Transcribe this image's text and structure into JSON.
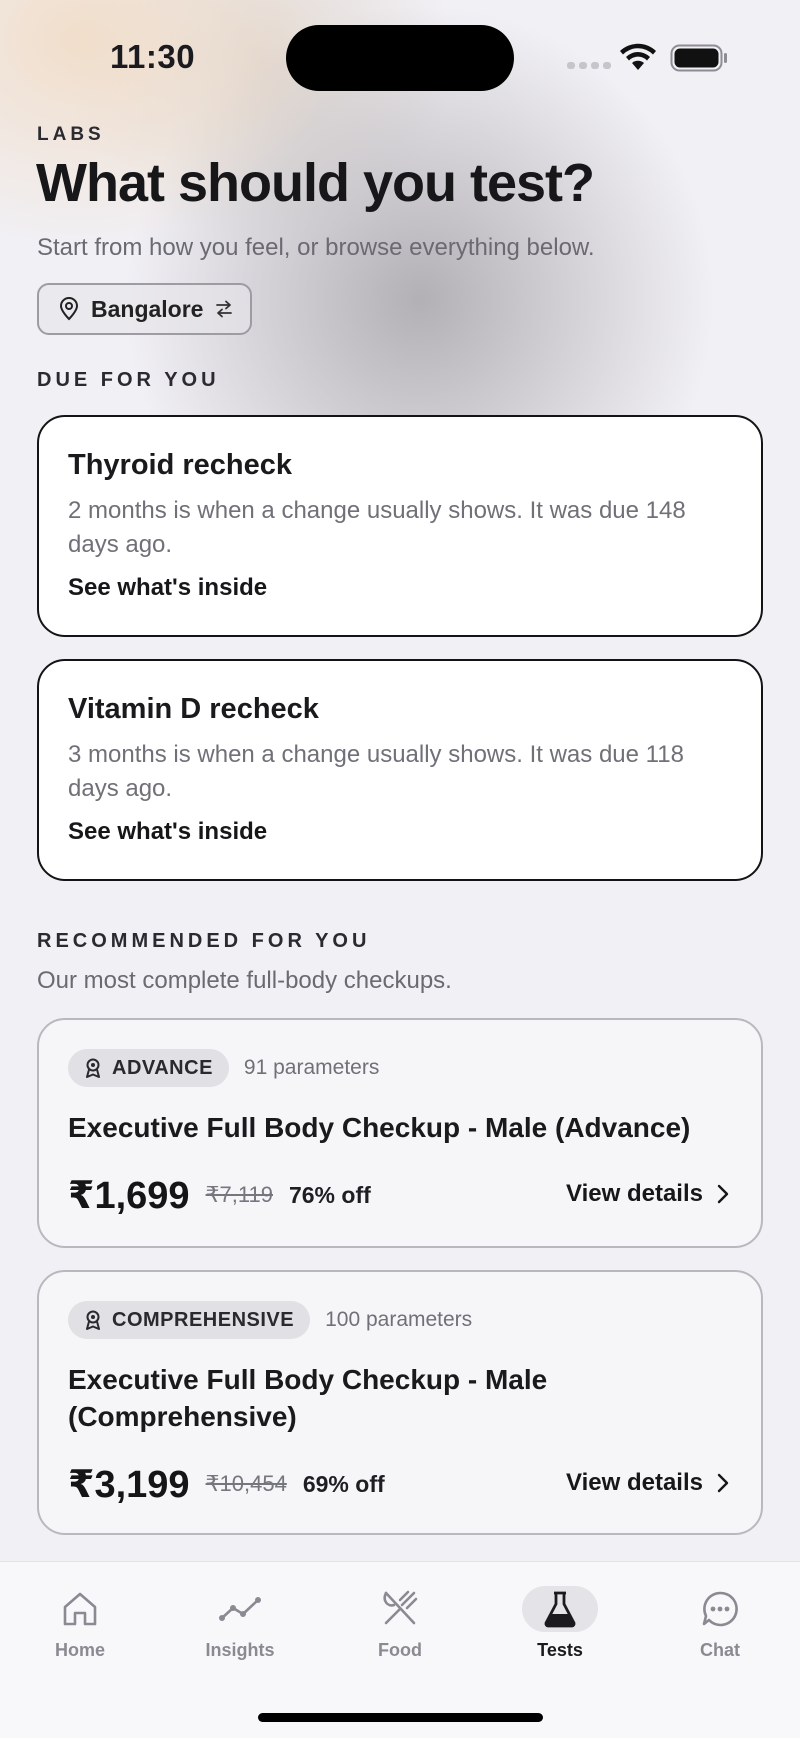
{
  "status_bar": {
    "time": "11:30"
  },
  "header": {
    "eyebrow": "LABS",
    "title": "What should you test?",
    "subtitle": "Start from how you feel, or browse everything below.",
    "location": "Bangalore"
  },
  "due_section": {
    "label": "DUE FOR YOU",
    "cards": [
      {
        "title": "Thyroid recheck",
        "description": "2 months is when a change usually shows. It was due 148 days ago.",
        "link": "See what's inside"
      },
      {
        "title": "Vitamin D recheck",
        "description": "3 months is when a change usually shows. It was due 118 days ago.",
        "link": "See what's inside"
      }
    ]
  },
  "recommended_section": {
    "label": "RECOMMENDED FOR YOU",
    "subtitle": "Our most complete full-body checkups.",
    "cards": [
      {
        "tier": "ADVANCE",
        "parameters": "91 parameters",
        "title": "Executive Full Body Checkup - Male (Advance)",
        "price": "₹1,699",
        "mrp": "₹7,119",
        "discount": "76% off",
        "cta": "View details"
      },
      {
        "tier": "COMPREHENSIVE",
        "parameters": "100 parameters",
        "title": "Executive Full Body Checkup - Male (Comprehensive)",
        "price": "₹3,199",
        "mrp": "₹10,454",
        "discount": "69% off",
        "cta": "View details"
      }
    ]
  },
  "tab_bar": {
    "active": "Tests",
    "tabs": [
      {
        "label": "Home",
        "icon": "home-icon"
      },
      {
        "label": "Insights",
        "icon": "insights-icon"
      },
      {
        "label": "Food",
        "icon": "food-icon"
      },
      {
        "label": "Tests",
        "icon": "flask-icon"
      },
      {
        "label": "Chat",
        "icon": "chat-icon"
      }
    ]
  },
  "colors": {
    "background": "#f1f0f5",
    "text_primary": "#17171a",
    "text_secondary": "#6b6a72",
    "card_border_due": "#141416",
    "tab_inactive": "#8b8a92"
  }
}
